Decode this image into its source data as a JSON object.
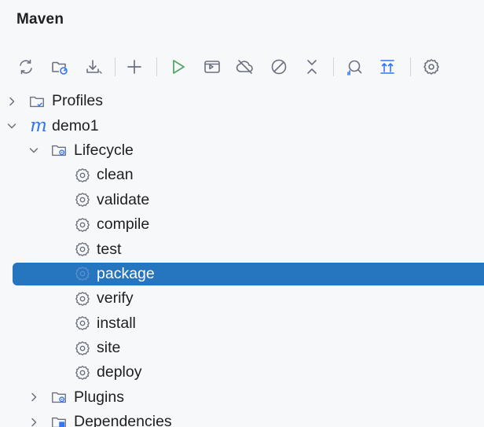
{
  "panel": {
    "title": "Maven"
  },
  "toolbar": {
    "buttons": [
      {
        "name": "reload-all-icon"
      },
      {
        "name": "reload-project-icon"
      },
      {
        "name": "download-sources-icon"
      },
      {
        "name": "add-project-icon"
      },
      {
        "name": "run-icon"
      },
      {
        "name": "execute-goal-icon"
      },
      {
        "name": "toggle-offline-icon"
      },
      {
        "name": "skip-tests-icon"
      },
      {
        "name": "collapse-all-icon"
      },
      {
        "name": "show-dependencies-icon"
      },
      {
        "name": "expand-all-icon"
      },
      {
        "name": "settings-icon"
      }
    ]
  },
  "tree": {
    "profiles": "Profiles",
    "project": "demo1",
    "lifecycle": "Lifecycle",
    "goals": [
      "clean",
      "validate",
      "compile",
      "test",
      "package",
      "verify",
      "install",
      "site",
      "deploy"
    ],
    "selected_goal": "package",
    "plugins": "Plugins",
    "dependencies": "Dependencies"
  },
  "colors": {
    "selection": "#2675bf",
    "accent_blue": "#3574f0",
    "run_green": "#55a76a",
    "icon_gray": "#6c707e"
  }
}
